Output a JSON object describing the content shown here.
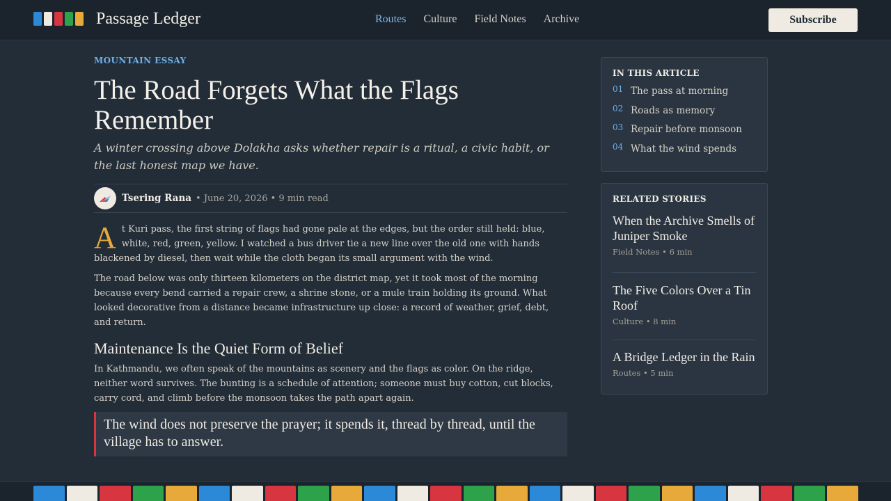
{
  "colors": {
    "blue": "#2b89d8",
    "white": "#efebe2",
    "red": "#d7353f",
    "green": "#2ea24a",
    "yellow": "#e6a93a",
    "accent": "#6db0ea",
    "background": "#232d38"
  },
  "header": {
    "brand": "Passage Ledger",
    "nav": [
      "Routes",
      "Culture",
      "Field Notes",
      "Archive"
    ],
    "active_nav": "Routes",
    "subscribe_label": "Subscribe"
  },
  "article": {
    "kicker": "MOUNTAIN ESSAY",
    "title": "The Road Forgets What the Flags Remember",
    "dek": "A winter crossing above Dolakha asks whether repair is a ritual, a civic habit, or the last honest map we have.",
    "author": "Tsering Rana",
    "meta": "• June 20, 2026 • 9 min read",
    "dropcap": "A",
    "lead": "t Kuri pass, the first string of flags had gone pale at the edges, but the order still held: blue, white, red, green, yellow. I watched a bus driver tie a new line over the old one with hands blackened by diesel, then wait while the cloth began its small argument with the wind.",
    "p2": "The road below was only thirteen kilometers on the district map, yet it took most of the morning because every bend carried a repair crew, a shrine stone, or a mule train holding its ground. What looked decorative from a distance became infrastructure up close: a record of weather, grief, debt, and return.",
    "subhead": "Maintenance Is the Quiet Form of Belief",
    "p3": "In Kathmandu, we often speak of the mountains as scenery and the flags as color. On the ridge, neither word survives. The bunting is a schedule of attention; someone must buy cotton, cut blocks, carry cord, and climb before the monsoon takes the path apart again.",
    "pullquote": "The wind does not preserve the prayer; it spends it, thread by thread, until the village has to answer."
  },
  "toc": {
    "title": "IN THIS ARTICLE",
    "items": [
      {
        "num": "01",
        "label": "The pass at morning"
      },
      {
        "num": "02",
        "label": "Roads as memory"
      },
      {
        "num": "03",
        "label": "Repair before monsoon"
      },
      {
        "num": "04",
        "label": "What the wind spends"
      }
    ]
  },
  "related": {
    "title": "RELATED STORIES",
    "stories": [
      {
        "title": "When the Archive Smells of Juniper Smoke",
        "meta": "Field Notes • 6 min"
      },
      {
        "title": "The Five Colors Over a Tin Roof",
        "meta": "Culture • 8 min"
      },
      {
        "title": "A Bridge Ledger in the Rain",
        "meta": "Routes • 5 min"
      }
    ]
  }
}
